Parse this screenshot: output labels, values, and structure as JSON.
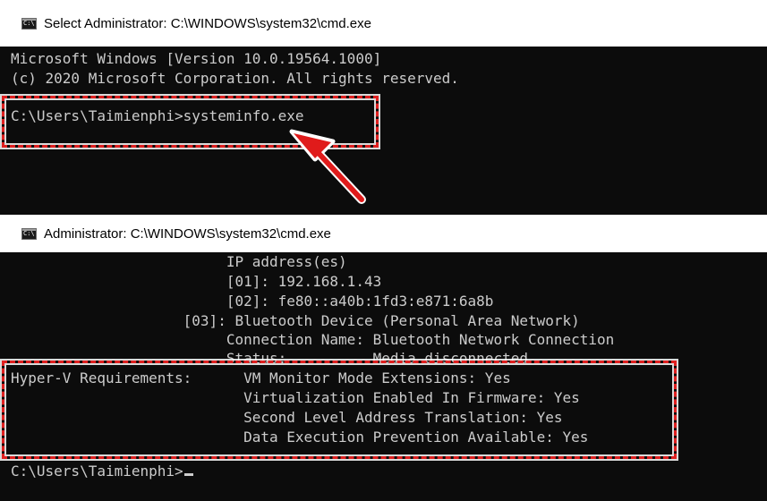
{
  "window1": {
    "title": "Select Administrator: C:\\WINDOWS\\system32\\cmd.exe",
    "lines": [
      "Microsoft Windows [Version 10.0.19564.1000]",
      "(c) 2020 Microsoft Corporation. All rights reserved.",
      "C:\\Users\\Taimienphi>systeminfo.exe"
    ]
  },
  "window2": {
    "title": "Administrator: C:\\WINDOWS\\system32\\cmd.exe",
    "lines": [
      "                         IP address(es)",
      "                         [01]: 192.168.1.43",
      "                         [02]: fe80::a40b:1fd3:e871:6a8b",
      "                    [03]: Bluetooth Device (Personal Area Network)",
      "                         Connection Name: Bluetooth Network Connection",
      "                         Status:          Media disconnected",
      "Hyper-V Requirements:      VM Monitor Mode Extensions: Yes",
      "                           Virtualization Enabled In Firmware: Yes",
      "                           Second Level Address Translation: Yes",
      "                           Data Execution Prevention Available: Yes",
      "C:\\Users\\Taimienphi>"
    ]
  },
  "colors": {
    "console_bg": "#0c0c0c",
    "console_text": "#cccccc",
    "highlight": "#e02020"
  }
}
